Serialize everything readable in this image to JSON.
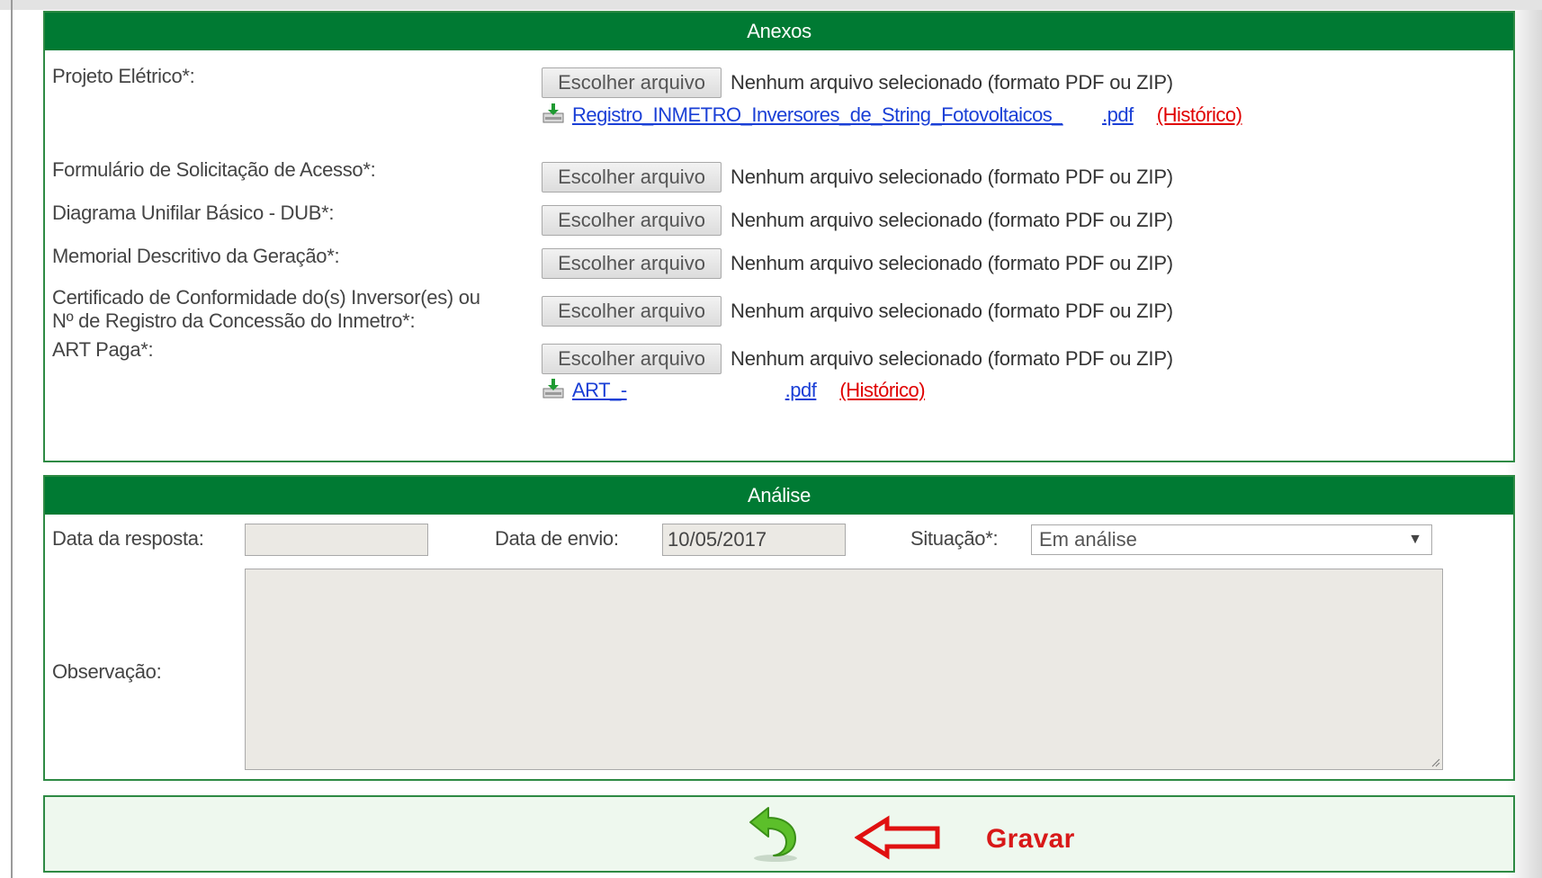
{
  "anexos": {
    "title": "Anexos",
    "rows": [
      {
        "label": "Projeto Elétrico*:",
        "button": "Escolher arquivo",
        "status": "Nenhum arquivo selecionado (formato PDF ou ZIP)",
        "file_link": "Registro_INMETRO_Inversores_de_String_Fotovoltaicos_",
        "file_ext": ".pdf",
        "history": "(Histórico)"
      },
      {
        "label": "Formulário de Solicitação de Acesso*:",
        "button": "Escolher arquivo",
        "status": "Nenhum arquivo selecionado (formato PDF ou ZIP)"
      },
      {
        "label": "Diagrama Unifilar Básico - DUB*:",
        "button": "Escolher arquivo",
        "status": "Nenhum arquivo selecionado (formato PDF ou ZIP)"
      },
      {
        "label": "Memorial Descritivo da Geração*:",
        "button": "Escolher arquivo",
        "status": "Nenhum arquivo selecionado (formato PDF ou ZIP)"
      },
      {
        "label_line1": "Certificado de Conformidade do(s) Inversor(es) ou",
        "label_line2": "Nº de Registro da Concessão do Inmetro*:",
        "button": "Escolher arquivo",
        "status": "Nenhum arquivo selecionado (formato PDF ou ZIP)"
      },
      {
        "label": "ART Paga*:",
        "button": "Escolher arquivo",
        "status": "Nenhum arquivo selecionado (formato PDF ou ZIP)",
        "file_link": "ART_-",
        "file_ext": ".pdf",
        "history": "(Histórico)"
      }
    ]
  },
  "analise": {
    "title": "Análise",
    "data_resposta_label": "Data da resposta:",
    "data_resposta_value": "",
    "data_envio_label": "Data de envio:",
    "data_envio_value": "10/05/2017",
    "situacao_label": "Situação*:",
    "situacao_value": "Em análise",
    "observacao_label": "Observação:",
    "observacao_value": ""
  },
  "actions": {
    "gravar_label": "Gravar",
    "back_icon": "undo-arrow-icon",
    "pointer_icon": "left-arrow-outline-icon"
  },
  "colors": {
    "header_green": "#007a33",
    "border_green": "#2e8a44",
    "link_blue": "#1a3fd6",
    "history_red": "#e00000",
    "gravar_red": "#d81818"
  }
}
